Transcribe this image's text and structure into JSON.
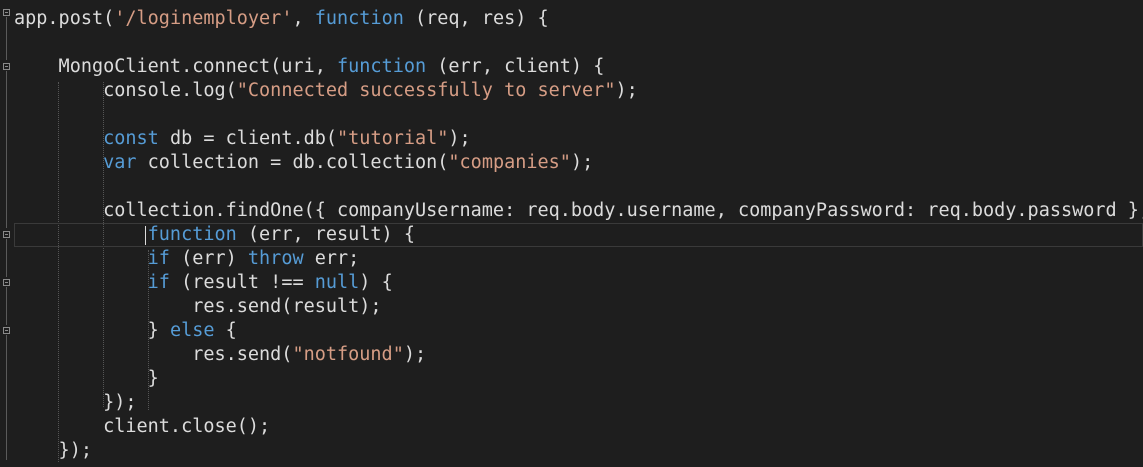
{
  "editor": {
    "lines": [
      [
        {
          "t": "app.post(",
          "c": "pl"
        },
        {
          "t": "'/loginemployer'",
          "c": "str"
        },
        {
          "t": ", ",
          "c": "pl"
        },
        {
          "t": "function",
          "c": "kw"
        },
        {
          "t": " (req, res) {",
          "c": "pl"
        }
      ],
      [],
      [
        {
          "t": "    MongoClient.connect(uri, ",
          "c": "pl"
        },
        {
          "t": "function",
          "c": "kw"
        },
        {
          "t": " (err, client) {",
          "c": "pl"
        }
      ],
      [
        {
          "t": "        console.log(",
          "c": "pl"
        },
        {
          "t": "\"Connected successfully to server\"",
          "c": "str"
        },
        {
          "t": ");",
          "c": "pl"
        }
      ],
      [],
      [
        {
          "t": "        ",
          "c": "pl"
        },
        {
          "t": "const",
          "c": "kw"
        },
        {
          "t": " db = client.db(",
          "c": "pl"
        },
        {
          "t": "\"tutorial\"",
          "c": "str"
        },
        {
          "t": ");",
          "c": "pl"
        }
      ],
      [
        {
          "t": "        ",
          "c": "pl"
        },
        {
          "t": "var",
          "c": "kw"
        },
        {
          "t": " collection = db.collection(",
          "c": "pl"
        },
        {
          "t": "\"companies\"",
          "c": "str"
        },
        {
          "t": ");",
          "c": "pl"
        }
      ],
      [],
      [
        {
          "t": "        collection.findOne({ companyUsername: req.body.username, companyPassword: req.body.password },",
          "c": "pl"
        }
      ],
      [
        {
          "t": "            ",
          "c": "pl"
        },
        {
          "t": "function",
          "c": "kw"
        },
        {
          "t": " (err, result) {",
          "c": "pl"
        }
      ],
      [
        {
          "t": "            ",
          "c": "pl"
        },
        {
          "t": "if",
          "c": "kw"
        },
        {
          "t": " (err) ",
          "c": "pl"
        },
        {
          "t": "throw",
          "c": "kw"
        },
        {
          "t": " err;",
          "c": "pl"
        }
      ],
      [
        {
          "t": "            ",
          "c": "pl"
        },
        {
          "t": "if",
          "c": "kw"
        },
        {
          "t": " (result !== ",
          "c": "pl"
        },
        {
          "t": "null",
          "c": "kw"
        },
        {
          "t": ") {",
          "c": "pl"
        }
      ],
      [
        {
          "t": "                res.send(result);",
          "c": "pl"
        }
      ],
      [
        {
          "t": "            } ",
          "c": "pl"
        },
        {
          "t": "else",
          "c": "kw"
        },
        {
          "t": " {",
          "c": "pl"
        }
      ],
      [
        {
          "t": "                res.send(",
          "c": "pl"
        },
        {
          "t": "\"notfound\"",
          "c": "str"
        },
        {
          "t": ");",
          "c": "pl"
        }
      ],
      [
        {
          "t": "            }",
          "c": "pl"
        }
      ],
      [
        {
          "t": "        });",
          "c": "pl"
        }
      ],
      [
        {
          "t": "        client.close();",
          "c": "pl"
        }
      ],
      [
        {
          "t": "    });",
          "c": "pl"
        }
      ]
    ]
  }
}
